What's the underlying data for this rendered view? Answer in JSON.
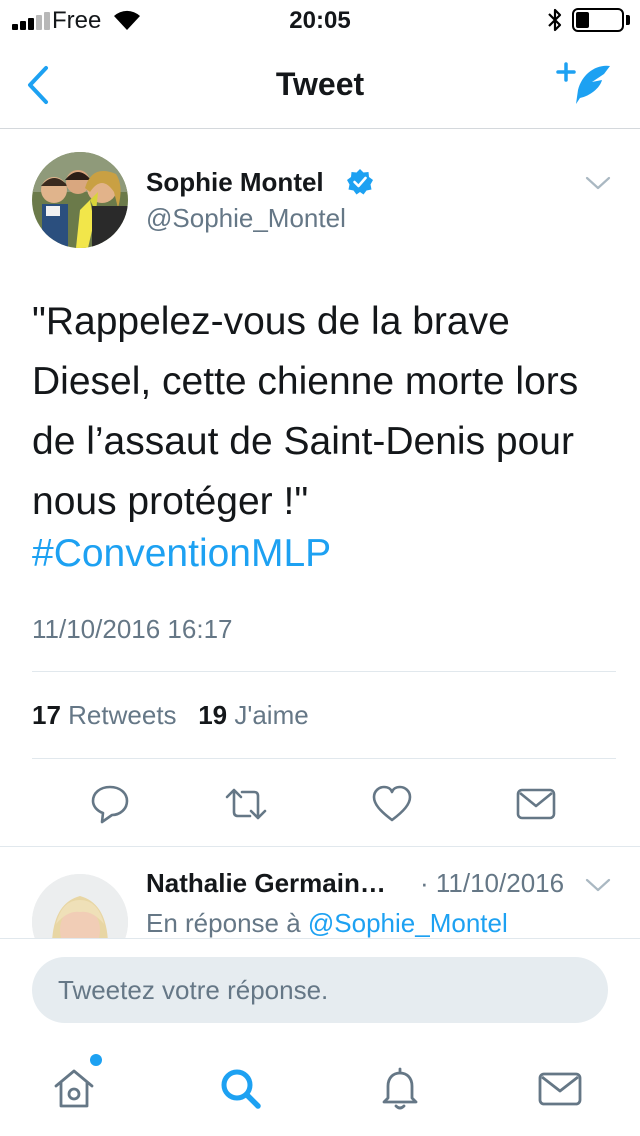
{
  "status_bar": {
    "carrier": "Free",
    "time": "20:05",
    "battery_level": 0.3
  },
  "nav": {
    "title": "Tweet",
    "back_icon": "chevron-left-icon",
    "compose_icon": "compose-tweet-icon"
  },
  "tweet": {
    "author_name": "Sophie Montel",
    "handle": "@Sophie_Montel",
    "verified": true,
    "text": "\"Rappelez-vous de la brave Diesel, cette chienne morte lors de l’assaut de Saint-Denis pour nous protéger !\"",
    "hashtag": "#ConventionMLP",
    "timestamp": "11/10/2016 16:17",
    "retweets_count": "17",
    "retweets_label": "Retweets",
    "likes_count": "19",
    "likes_label": "J'aime",
    "actions": [
      "reply-icon",
      "retweet-icon",
      "like-icon",
      "direct-message-icon"
    ]
  },
  "reply": {
    "author_name": "Nathalie Germain…",
    "date": "· 11/10/2016",
    "in_reply_to_prefix": "En réponse à",
    "in_reply_to_handle": "@Sophie_Montel"
  },
  "composer": {
    "placeholder": "Tweetez votre réponse."
  },
  "tabbar": {
    "tabs": [
      "home-icon",
      "search-icon",
      "notifications-icon",
      "messages-icon"
    ],
    "active": "search-icon"
  },
  "colors": {
    "accent": "#1da1f2",
    "text_primary": "#14171a",
    "text_secondary": "#657786",
    "input_background": "#e6ecf0"
  }
}
